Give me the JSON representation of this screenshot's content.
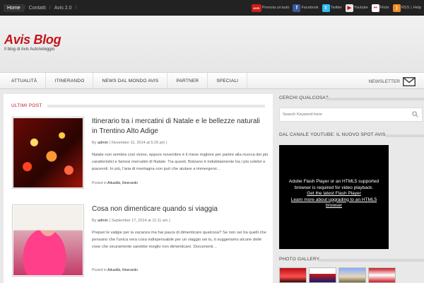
{
  "topnav": {
    "items": [
      "Home",
      "Contatti",
      "Avis 2.0"
    ]
  },
  "social": {
    "avis_icon": "AVIS",
    "items": [
      {
        "icon": "avis-icon",
        "label": "Prenota un'auto"
      },
      {
        "icon": "facebook-icon",
        "label": "Facebook"
      },
      {
        "icon": "twitter-icon",
        "label": "Twitter"
      },
      {
        "icon": "youtube-icon",
        "label": "Youtube"
      },
      {
        "icon": "flickr-icon",
        "label": "Flickr"
      }
    ],
    "rss": "RSS",
    "help": "Help"
  },
  "header": {
    "logo": "Avis Blog",
    "tagline": "Il blog di Avis Autonoleggio"
  },
  "nav": {
    "items": [
      "ATTUALITÀ",
      "ITINERANDO",
      "NEWS DAL MONDO AVIS",
      "PARTNER",
      "SPECIALI"
    ],
    "newsletter": "NEWSLETTER"
  },
  "content": {
    "section_title": "ULTIMI POST",
    "posts": [
      {
        "title": "Itinerario tra i mercatini di Natale e le bellezze naturali in Trentino Alto Adige",
        "by": "By",
        "author": "admin",
        "date": "( November 11, 2014 at 5:29 pm )",
        "excerpt": "Natale non sembra così vicino, eppure novembre è il mese migliore per partire alla ricerca dei più caratteristici e famosi mercatini di Natale. Tra questi, Bolzano è indubbiamente tra i più celebri e piacevoli. In più, l'aria di montagna non può che aiutare a immergersi…",
        "posted_in": "Posted in",
        "categories": "Attualità, Itinerando"
      },
      {
        "title": "Cosa non dimenticare quando si viaggia",
        "by": "By",
        "author": "admin",
        "date": "( September 17, 2014 at 11:11 am )",
        "excerpt": "Prepari le valigie per la vacanza ma hai paura di dimenticare qualcosa? Se non sei tra quelli che pensano che l'unica vera cosa indispensabile per un viaggio sei tu, ti suggeriamo alcune delle cose che sicuramente sarebbe meglio non dimenticare. Documenti…",
        "posted_in": "Posted in",
        "categories": "Attualità, Itinerando"
      }
    ]
  },
  "sidebar": {
    "search_title": "CERCHI QUALCOSA?",
    "search_placeholder": "Search Keyword here",
    "video_title": "DAL CANALE YOUTUBE: IL NUOVO SPOT AVIS",
    "video_lines": [
      "Adobe Flash Player or an HTML5 supported",
      "browser is required for video playback.",
      "Get the latest Flash Player",
      "Learn more about upgrading to an HTML5",
      "browser"
    ],
    "gallery_title": "PHOTO GALLERY"
  }
}
